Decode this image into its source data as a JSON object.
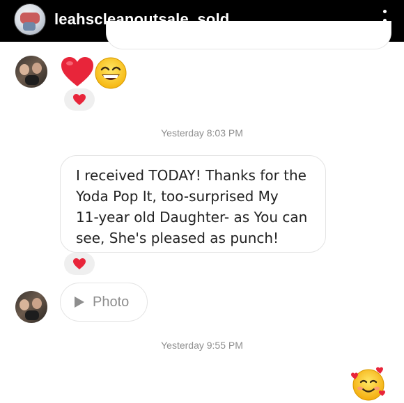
{
  "header": {
    "username": "leahscleanoutsale_sold",
    "avatar_icon": "profile-avatar",
    "menu_icon": "more-vertical-icon"
  },
  "messages": {
    "emoji_message": {
      "emojis": [
        "red-heart-emoji",
        "grinning-face-emoji"
      ],
      "reaction": "red-heart"
    },
    "timestamp_1": "Yesterday 8:03 PM",
    "text_message": {
      "lines": [
        "I received TODAY! Thanks for the",
        "Yoda Pop It, too-surprised My",
        "11-year old Daughter- as You can",
        "see, She's pleased as punch!"
      ],
      "reaction": "red-heart"
    },
    "photo_message": {
      "label": "Photo"
    },
    "timestamp_2": "Yesterday 9:55 PM",
    "outgoing_emoji": "smiling-face-with-hearts-emoji"
  },
  "colors": {
    "header_bg": "#000000",
    "timestamp": "#8e8e8e",
    "bubble_border": "#e3e3e3",
    "heart_red": "#e8253a"
  }
}
